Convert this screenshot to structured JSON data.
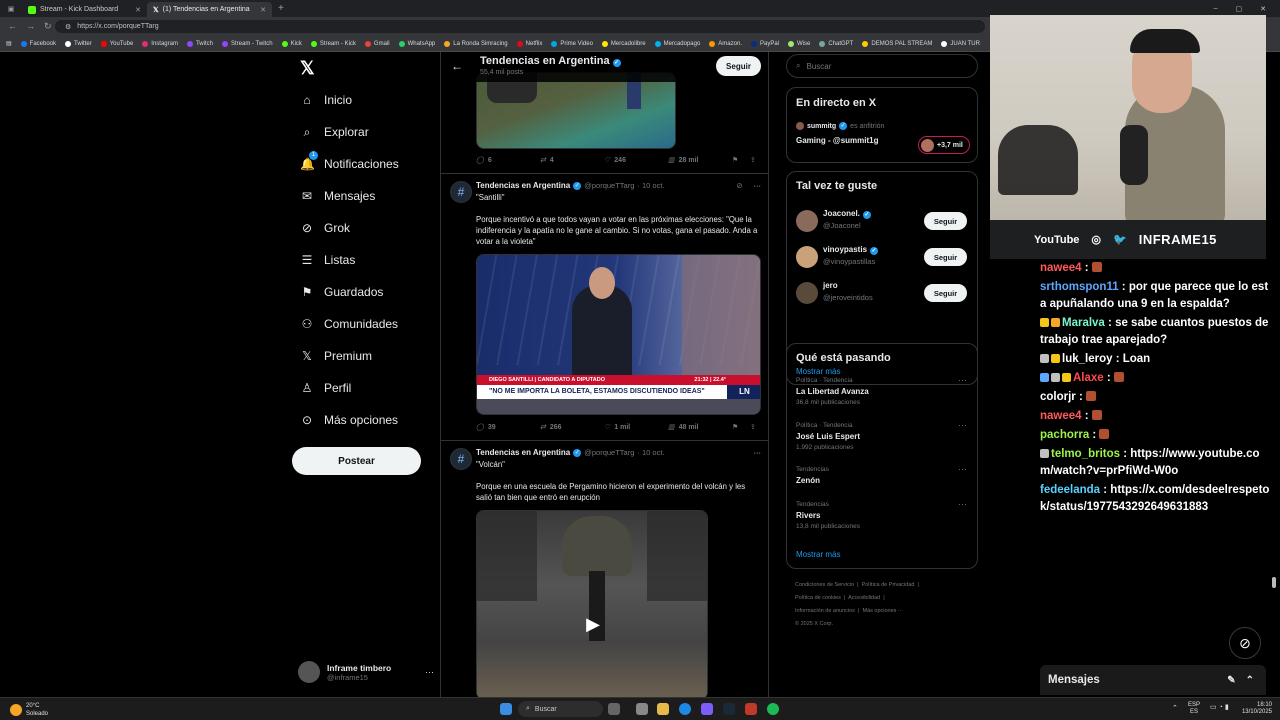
{
  "browser": {
    "tabs": [
      {
        "label": "Stream - Kick Dashboard",
        "color": "#53fc18"
      },
      {
        "label": "(1) Tendencias en Argentina",
        "color": "#ffffff"
      }
    ],
    "url": "https://x.com/porqueTTarg",
    "bookmarks": [
      "Facebook",
      "Twitter",
      "YouTube",
      "Instagram",
      "Twitch",
      "Stream - Twitch",
      "Kick",
      "Stream - Kick",
      "Gmail",
      "WhatsApp",
      "La Ronda Simracing",
      "Netflix",
      "Prime Video",
      "Mercadolibre",
      "Mercadopago",
      "Amazon.",
      "PayPal",
      "Wise",
      "ChatGPT",
      "DEMOS PAL STREAM",
      "JUAN TUR"
    ]
  },
  "leftnav": {
    "items": [
      {
        "label": "Inicio",
        "icon": "home-icon",
        "glyph": "⌂"
      },
      {
        "label": "Explorar",
        "icon": "search-icon",
        "glyph": "⌕"
      },
      {
        "label": "Notificaciones",
        "icon": "bell-icon",
        "glyph": "🔔"
      },
      {
        "label": "Mensajes",
        "icon": "mail-icon",
        "glyph": "✉"
      },
      {
        "label": "Grok",
        "icon": "grok-icon",
        "glyph": "⊘"
      },
      {
        "label": "Listas",
        "icon": "list-icon",
        "glyph": "☰"
      },
      {
        "label": "Guardados",
        "icon": "bookmark-icon",
        "glyph": "⚑"
      },
      {
        "label": "Comunidades",
        "icon": "community-icon",
        "glyph": "⚇"
      },
      {
        "label": "Premium",
        "icon": "x-premium-icon",
        "glyph": "𝕏"
      },
      {
        "label": "Perfil",
        "icon": "profile-icon",
        "glyph": "♙"
      },
      {
        "label": "Más opciones",
        "icon": "more-icon",
        "glyph": "⊙"
      }
    ],
    "notif_count": "1",
    "post_label": "Postear",
    "profile": {
      "name": "Inframe timbero",
      "handle": "@inframe15"
    }
  },
  "center": {
    "title": "Tendencias en Argentina",
    "subtitle": "55,4 mil posts",
    "follow_label": "Seguir",
    "tweet0_actions": {
      "replies": "6",
      "retweets": "4",
      "likes": "246",
      "views": "28 mil"
    },
    "tweets": [
      {
        "author": "Tendencias en Argentina",
        "handle": "@porqueTTarg",
        "date": "· 10 oct.",
        "title": "\"Santilli\"",
        "body": "Porque incentivó a que todos vayan a votar en las próximas elecciones: \"Que la indiferencia y la apatía no le gane al cambio. Si no votas, gana el pasado. Anda a votar a la violeta\"",
        "chyron_top": "DIEGO SANTILLI | CANDIDATO A DIPUTADO",
        "chyron_main": "\"NO ME IMPORTA LA BOLETA, ESTAMOS DISCUTIENDO IDEAS\"",
        "chyron_time": "21:32 | 22.4°",
        "actions": {
          "replies": "39",
          "retweets": "266",
          "likes": "1 mil",
          "views": "48 mil"
        }
      },
      {
        "author": "Tendencias en Argentina",
        "handle": "@porqueTTarg",
        "date": "· 10 oct.",
        "title": "\"Volcán\"",
        "body": "Porque en una escuela de Pergamino hicieron el experimento del volcán y les salió tan bien que entró en erupción"
      }
    ]
  },
  "right": {
    "search_placeholder": "Buscar",
    "live": {
      "heading": "En directo en X",
      "host": "summitg",
      "host_role": "es anfitrión",
      "title": "Gaming - @summit1g",
      "listeners": "+3,7 mil"
    },
    "suggest": {
      "heading": "Tal vez te guste",
      "users": [
        {
          "name": "Joaconel.",
          "handle": "@Joaconel",
          "avatar_color": "#8a6a5a"
        },
        {
          "name": "vinoypastis",
          "handle": "@vinoypastillas",
          "avatar_color": "#c9a27a"
        },
        {
          "name": "jero",
          "handle": "@jeroveintidos",
          "avatar_color": "#5a4a3a"
        }
      ],
      "follow_label": "Seguir",
      "more": "Mostrar más"
    },
    "trends": {
      "heading": "Qué está pasando",
      "items": [
        {
          "context": "Política · Tendencia",
          "name": "La Libertad Avanza",
          "count": "36,8 mil publicaciones"
        },
        {
          "context": "Política · Tendencia",
          "name": "José Luis Espert",
          "count": "1.992 publicaciones"
        },
        {
          "context": "Tendencias",
          "name": "Zenón",
          "count": ""
        },
        {
          "context": "Tendencias",
          "name": "Rivers",
          "count": "13,8 mil publicaciones"
        }
      ],
      "more": "Mostrar más"
    },
    "footer": [
      "Condiciones de Servicio",
      "Política de Privacidad",
      "Política de cookies",
      "Accesibilidad",
      "Información de anuncios",
      "Más opciones ···",
      "© 2025 X Corp."
    ]
  },
  "stream": {
    "overlay": {
      "youtube": "YouTube",
      "handle": "INFRAME15"
    },
    "chat": [
      {
        "user": "nawee4",
        "color": "#ff5a5a",
        "text": " : ",
        "emote": true,
        "badges": []
      },
      {
        "user": "srthomspon11",
        "color": "#5aa8ff",
        "text": " : por que parece que lo esta apuñalando una 9 en la espalda?",
        "badges": []
      },
      {
        "user": "Maralva",
        "color": "#7cf5d0",
        "text": " : se sabe cuantos puestos de trabajo trae aparejado?",
        "badges": [
          "#f5c518",
          "#f5a623"
        ]
      },
      {
        "user": "luk_leroy",
        "color": "#ffffff",
        "text": " : Loan",
        "badges": [
          "#c0c0c0",
          "#f5c518"
        ]
      },
      {
        "user": "Alaxe",
        "color": "#ff4b4b",
        "text": " : ",
        "emote": true,
        "badges": [
          "#5aa8ff",
          "#c0c0c0",
          "#f5c518"
        ]
      },
      {
        "user": "colorjr",
        "color": "#ffffff",
        "text": " : ",
        "emote": true,
        "badges": []
      },
      {
        "user": "nawee4",
        "color": "#ff5a5a",
        "text": " : ",
        "emote": true,
        "badges": []
      },
      {
        "user": "pachorra",
        "color": "#9ef24a",
        "text": " : ",
        "emote": true,
        "badges": []
      },
      {
        "user": "telmo_britos",
        "color": "#9ef24a",
        "text": " : https://www.youtube.com/watch?v=prPfiWd-W0o",
        "badges": [
          "#c0c0c0"
        ]
      },
      {
        "user": "fedeelanda",
        "color": "#5ad1ff",
        "text": " : https://x.com/desdeelrespetok/status/1977543292649631883",
        "badges": []
      }
    ],
    "messages_label": "Mensajes"
  },
  "taskbar": {
    "weather_temp": "20°C",
    "weather_desc": "Soleado",
    "search": "Buscar",
    "lang": "ESP",
    "lang_sub": "ES",
    "time": "18:10",
    "date": "13/10/2025"
  }
}
